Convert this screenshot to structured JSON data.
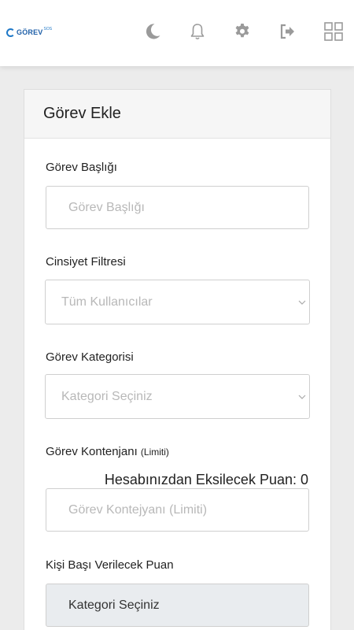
{
  "header": {
    "logo": {
      "text": "GÖREV",
      "suffix": "SOS"
    },
    "icons": [
      "moon-icon",
      "bell-icon",
      "gear-icon",
      "logout-icon",
      "grid-icon"
    ]
  },
  "form": {
    "title": "Görev Ekle",
    "task_title": {
      "label": "Görev Başlığı",
      "placeholder": "Görev Başlığı"
    },
    "gender_filter": {
      "label": "Cinsiyet Filtresi",
      "selected": "Tüm Kullanıcılar"
    },
    "task_category": {
      "label": "Görev Kategorisi",
      "selected": "Kategori Seçiniz"
    },
    "task_quota": {
      "label": "Görev Kontenjanı",
      "label_note": "(Limiti)",
      "deduction_text": "Hesabınızdan Eksilecek Puan: 0",
      "placeholder": "Görev Kontejyanı (Limiti)"
    },
    "per_person_points": {
      "label": "Kişi Başı Verilecek Puan",
      "value": "Kategori Seçiniz"
    }
  }
}
